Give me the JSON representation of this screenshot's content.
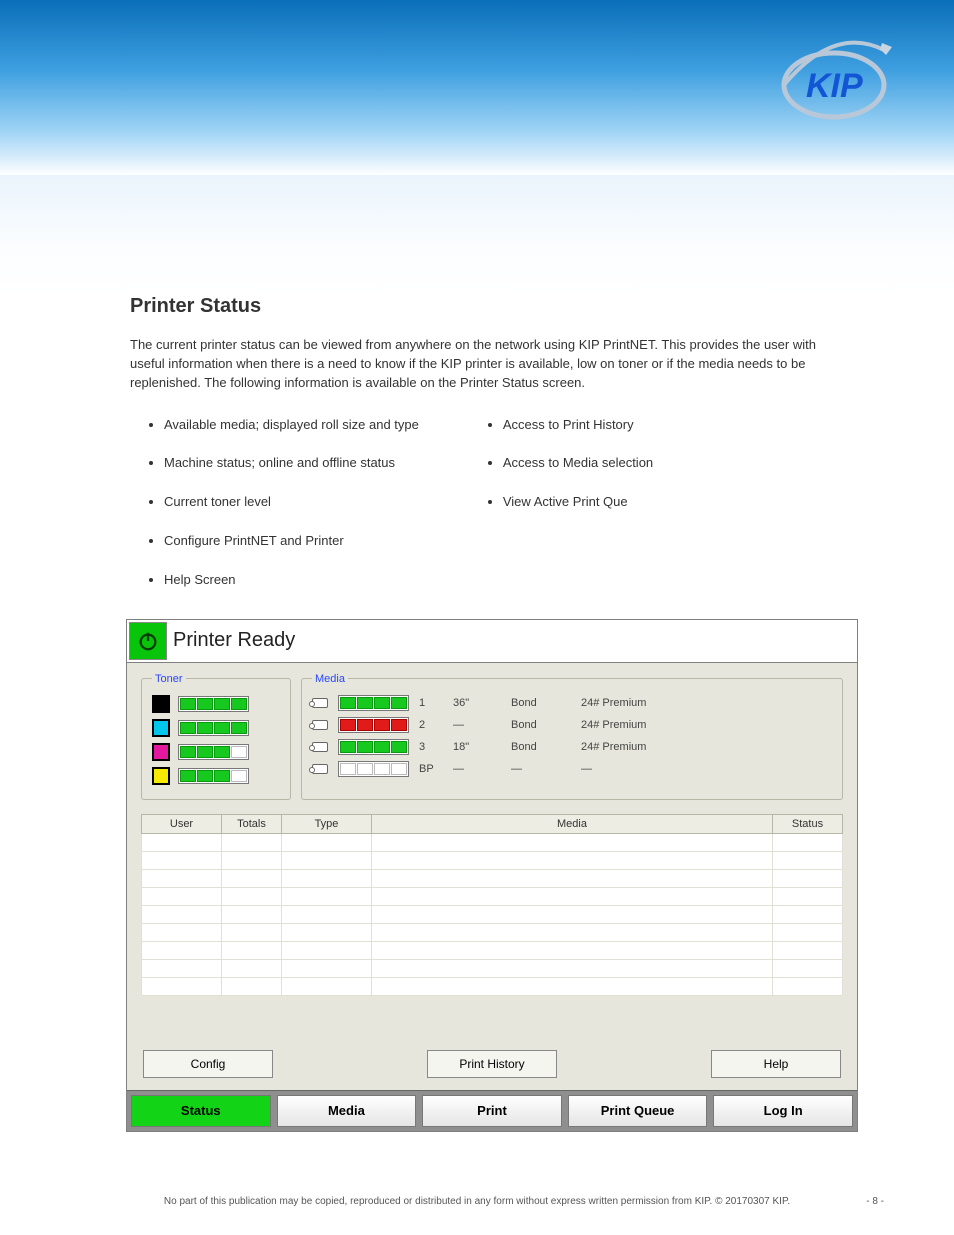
{
  "doc": {
    "section_title": "Printer Status",
    "intro": "The current printer status can be viewed from anywhere on the network using KIP PrintNET. This provides the user with useful information when there is a need to know if the KIP printer is available, low on toner or if the media needs to be replenished. The following information is available on the Printer Status screen."
  },
  "bullets_left": [
    "Available media; displayed roll size and type",
    "Machine status; online and offline status",
    "Current toner level",
    "Configure PrintNET and Printer",
    "Help Screen"
  ],
  "bullets_right": [
    "Access to Print History",
    "Access to Media selection",
    "View Active Print Que"
  ],
  "ui": {
    "title": "Printer Ready",
    "toner_label": "Toner",
    "media_label": "Media",
    "toner": [
      {
        "color": "#000000",
        "segs": [
          "g",
          "g",
          "g",
          "g"
        ]
      },
      {
        "color": "#00c6ec",
        "segs": [
          "g",
          "g",
          "g",
          "g"
        ]
      },
      {
        "color": "#e3189c",
        "segs": [
          "g",
          "g",
          "g",
          "e"
        ]
      },
      {
        "color": "#f6ea00",
        "segs": [
          "g",
          "g",
          "g",
          "e"
        ]
      }
    ],
    "media": [
      {
        "segs": [
          "g",
          "g",
          "g",
          "g"
        ],
        "num": "1",
        "size": "36\"",
        "type": "Bond",
        "desc": "24# Premium"
      },
      {
        "segs": [
          "r",
          "r",
          "r",
          "r"
        ],
        "num": "2",
        "size": "—",
        "type": "Bond",
        "desc": "24# Premium"
      },
      {
        "segs": [
          "g",
          "g",
          "g",
          "g"
        ],
        "num": "3",
        "size": "18\"",
        "type": "Bond",
        "desc": "24# Premium"
      },
      {
        "segs": [
          "e",
          "e",
          "e",
          "e"
        ],
        "num": "BP",
        "size": "—",
        "type": "—",
        "desc": "—"
      }
    ],
    "table_headers": {
      "user": "User",
      "totals": "Totals",
      "type": "Type",
      "media": "Media",
      "status": "Status"
    },
    "mid": {
      "config": "Config",
      "history": "Print History",
      "help": "Help"
    },
    "tabs": {
      "status": "Status",
      "media": "Media",
      "print": "Print",
      "queue": "Print Queue",
      "login": "Log In"
    }
  },
  "footer": {
    "text": "No part of this publication may be copied, reproduced or distributed in any form without express written permission from KIP. © 20170307 KIP.",
    "page": "- 8 -"
  }
}
